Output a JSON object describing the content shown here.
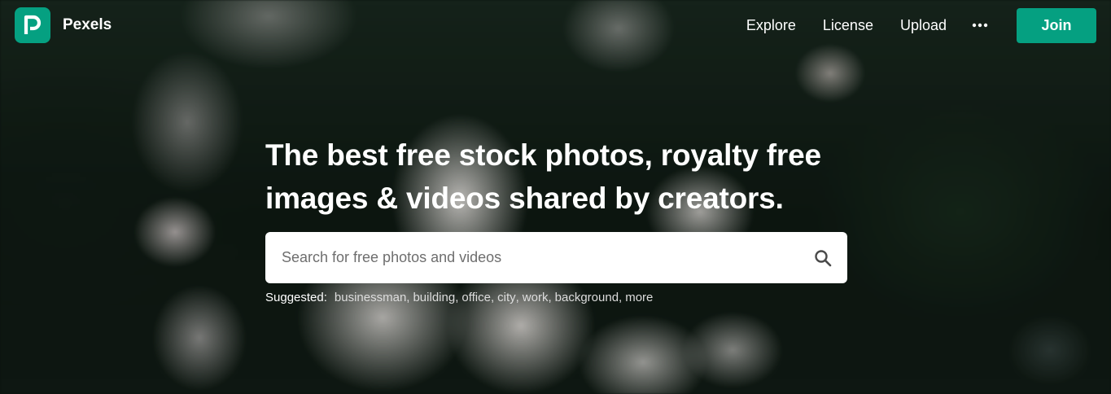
{
  "brand": {
    "name": "Pexels",
    "logo_icon": "pexels-p-logo-icon",
    "accent_color": "#05a081"
  },
  "nav": {
    "links": [
      "Explore",
      "License",
      "Upload"
    ],
    "more_icon": "more-dots-icon",
    "join_label": "Join"
  },
  "hero": {
    "headline_line1": "The best free stock photos, royalty free",
    "headline_line2": "images & videos shared by creators."
  },
  "search": {
    "placeholder": "Search for free photos and videos",
    "value": "",
    "icon": "search-icon"
  },
  "suggested": {
    "label": "Suggested:",
    "items": [
      "businessman",
      "building",
      "office",
      "city",
      "work",
      "background",
      "more"
    ]
  }
}
